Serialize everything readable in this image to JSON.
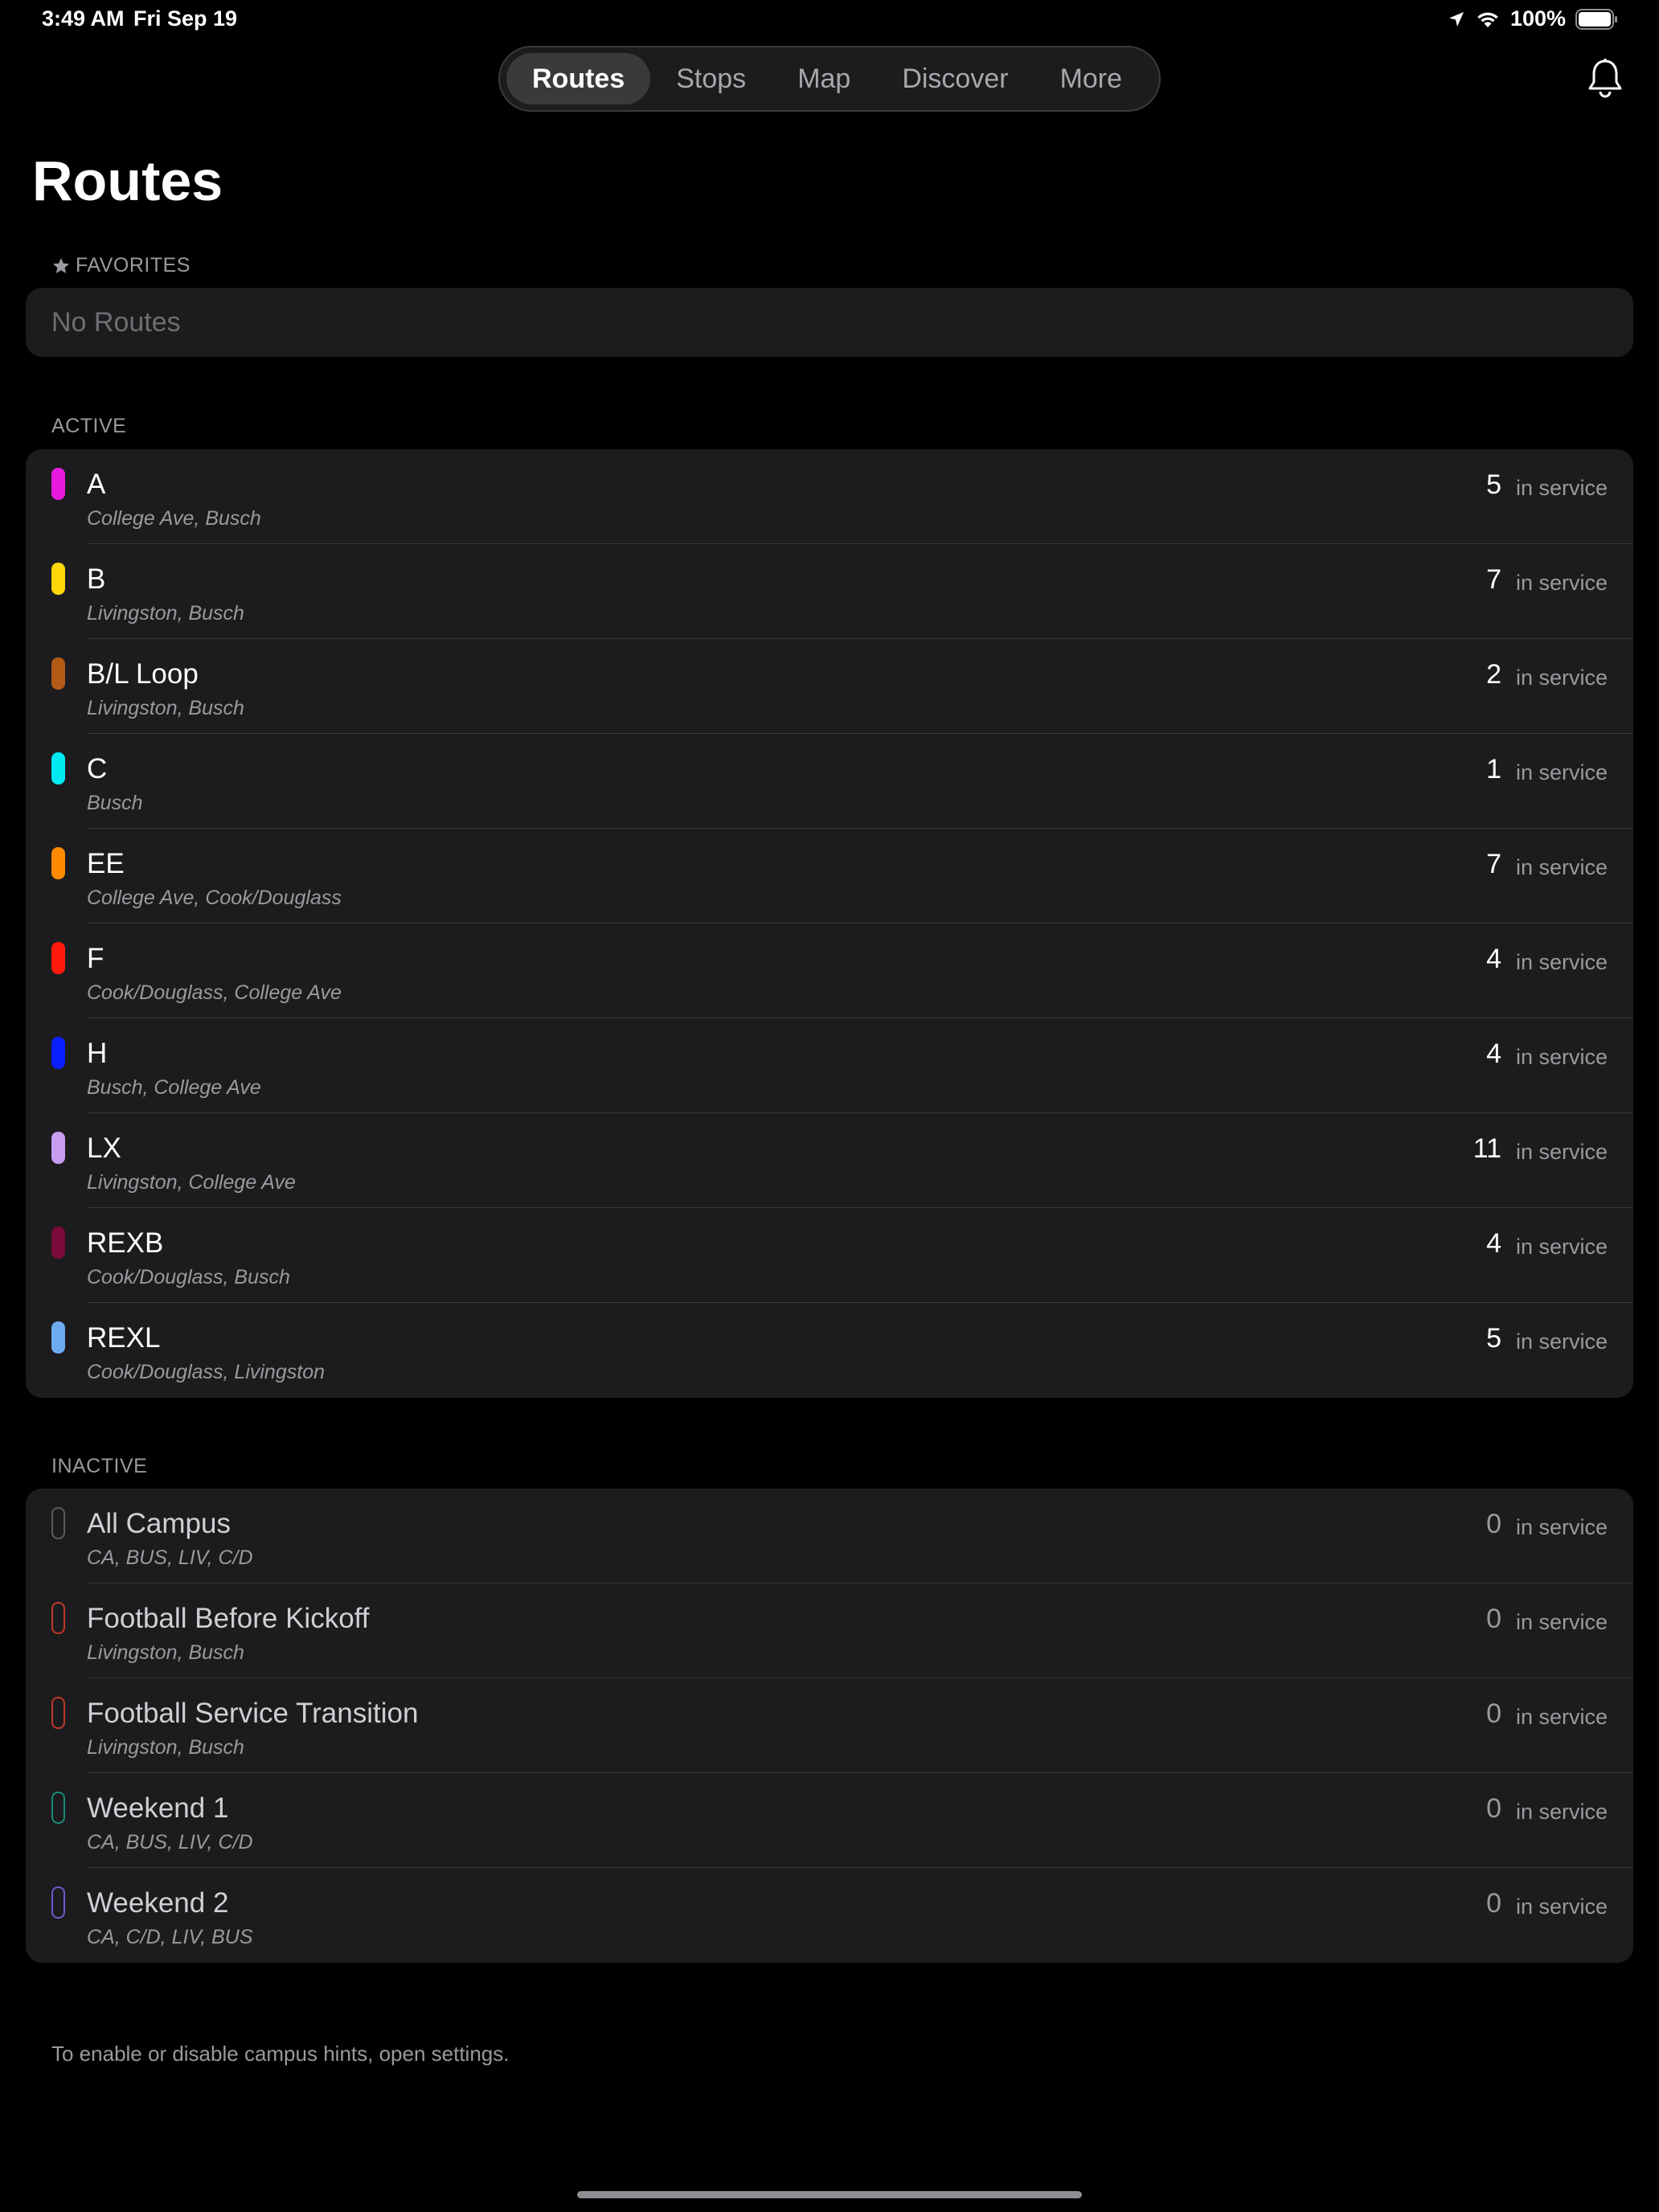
{
  "status_bar": {
    "time": "3:49 AM",
    "date": "Fri Sep 19",
    "battery": "100%"
  },
  "nav": {
    "tabs": [
      "Routes",
      "Stops",
      "Map",
      "Discover",
      "More"
    ],
    "active": 0
  },
  "page": {
    "title": "Routes"
  },
  "favorites": {
    "header": "FAVORITES",
    "empty_text": "No Routes"
  },
  "active_section": {
    "header": "ACTIVE",
    "routes": [
      {
        "name": "A",
        "campuses": "College Ave, Busch",
        "count": "5",
        "status": "in service",
        "color": "#e91adf"
      },
      {
        "name": "B",
        "campuses": "Livingston, Busch",
        "count": "7",
        "status": "in service",
        "color": "#ffd60a"
      },
      {
        "name": "B/L Loop",
        "campuses": "Livingston, Busch",
        "count": "2",
        "status": "in service",
        "color": "#b25b17"
      },
      {
        "name": "C",
        "campuses": "Busch",
        "count": "1",
        "status": "in service",
        "color": "#00e8f0"
      },
      {
        "name": "EE",
        "campuses": "College Ave, Cook/Douglass",
        "count": "7",
        "status": "in service",
        "color": "#ff8a00"
      },
      {
        "name": "F",
        "campuses": "Cook/Douglass, College Ave",
        "count": "4",
        "status": "in service",
        "color": "#ff1a0d"
      },
      {
        "name": "H",
        "campuses": "Busch, College Ave",
        "count": "4",
        "status": "in service",
        "color": "#0a1fff"
      },
      {
        "name": "LX",
        "campuses": "Livingston, College Ave",
        "count": "11",
        "status": "in service",
        "color": "#c89cf0"
      },
      {
        "name": "REXB",
        "campuses": "Cook/Douglass, Busch",
        "count": "4",
        "status": "in service",
        "color": "#7a0a3a"
      },
      {
        "name": "REXL",
        "campuses": "Cook/Douglass, Livingston",
        "count": "5",
        "status": "in service",
        "color": "#6eaaf0"
      }
    ]
  },
  "inactive_section": {
    "header": "INACTIVE",
    "routes": [
      {
        "name": "All Campus",
        "campuses": "CA, BUS, LIV, C/D",
        "count": "0",
        "status": "in service",
        "color": "#5a5a5e"
      },
      {
        "name": "Football Before Kickoff",
        "campuses": "Livingston, Busch",
        "count": "0",
        "status": "in service",
        "color": "#c0392b"
      },
      {
        "name": "Football Service Transition",
        "campuses": "Livingston, Busch",
        "count": "0",
        "status": "in service",
        "color": "#c0392b"
      },
      {
        "name": "Weekend 1",
        "campuses": "CA, BUS, LIV, C/D",
        "count": "0",
        "status": "in service",
        "color": "#1a8a78"
      },
      {
        "name": "Weekend 2",
        "campuses": "CA, C/D, LIV, BUS",
        "count": "0",
        "status": "in service",
        "color": "#6a5acd"
      }
    ]
  },
  "footer": {
    "note": "To enable or disable campus hints, open settings."
  }
}
